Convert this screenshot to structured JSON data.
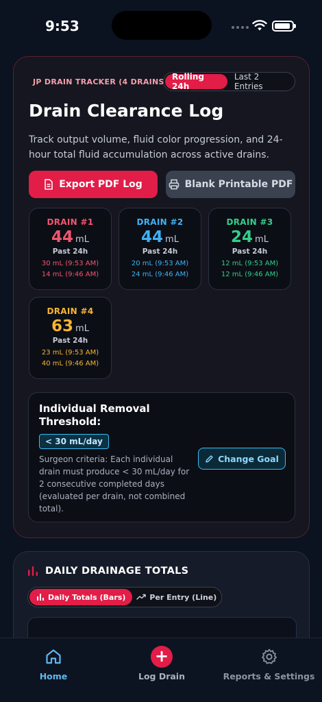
{
  "status_bar": {
    "time": "9:53"
  },
  "tracker": {
    "label": "JP DRAIN TRACKER (4 DRAINS)",
    "toggle_active": "Rolling 24h",
    "toggle_inactive": "Last 2 Entries"
  },
  "header": {
    "title": "Drain Clearance Log",
    "description": "Track output volume, fluid color progression, and 24-hour total fluid accumulation across active drains."
  },
  "actions": {
    "export_label": "Export PDF Log",
    "blank_label": "Blank Printable PDF"
  },
  "drains": [
    {
      "name": "DRAIN #1",
      "value": "44",
      "unit": "mL",
      "period": "Past 24h",
      "color": "#f0566f",
      "entries": [
        "30 mL (9:53 AM)",
        "14 mL (9:46 AM)"
      ]
    },
    {
      "name": "DRAIN #2",
      "value": "44",
      "unit": "mL",
      "period": "Past 24h",
      "color": "#3fb2f3",
      "entries": [
        "20 mL (9:53 AM)",
        "24 mL (9:46 AM)"
      ]
    },
    {
      "name": "DRAIN #3",
      "value": "24",
      "unit": "mL",
      "period": "Past 24h",
      "color": "#31cf8a",
      "entries": [
        "12 mL (9:53 AM)",
        "12 mL (9:46 AM)"
      ]
    },
    {
      "name": "DRAIN #4",
      "value": "63",
      "unit": "mL",
      "period": "Past 24h",
      "color": "#f6b532",
      "entries": [
        "23 mL (9:53 AM)",
        "40 mL (9:46 AM)"
      ]
    }
  ],
  "threshold": {
    "title": "Individual Removal Threshold:",
    "badge": "< 30 mL/day",
    "criteria": "Surgeon criteria: Each individual drain must produce < 30 mL/day for 2 consecutive completed days (evaluated per drain, not combined total).",
    "change_goal_label": "Change Goal"
  },
  "totals": {
    "title": "DAILY DRAINAGE TOTALS",
    "toggle_active": "Daily Totals (Bars)",
    "toggle_inactive": "Per Entry (Line)"
  },
  "nav": {
    "home": "Home",
    "log": "Log Drain",
    "reports": "Reports & Settings"
  },
  "colors": {
    "accent": "#e11d48",
    "info": "#38bdf8",
    "background": "#0b1220"
  }
}
